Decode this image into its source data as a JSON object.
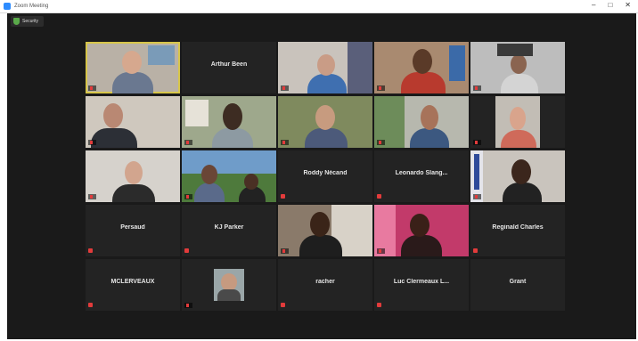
{
  "window": {
    "title": "Zoom Meeting"
  },
  "toolbar": {
    "security_label": "Security"
  },
  "colors": {
    "speaking_border": "#d7c64a",
    "mute": "#e23b3b",
    "tile_bg": "#232323",
    "meeting_bg": "#1a1a1a"
  },
  "participants": [
    {
      "name": "",
      "video": true
    },
    {
      "name": "Arthur Been",
      "video": false
    },
    {
      "name": "",
      "video": true
    },
    {
      "name": "",
      "video": true
    },
    {
      "name": "",
      "video": true
    },
    {
      "name": "",
      "video": true
    },
    {
      "name": "",
      "video": true
    },
    {
      "name": "",
      "video": true
    },
    {
      "name": "",
      "video": true
    },
    {
      "name": "",
      "video": true
    },
    {
      "name": "",
      "video": true
    },
    {
      "name": "",
      "video": true
    },
    {
      "name": "Roddy Nécand",
      "video": false
    },
    {
      "name": "Leonardo Slang...",
      "video": false
    },
    {
      "name": "",
      "video": true
    },
    {
      "name": "Persaud",
      "video": false
    },
    {
      "name": "KJ Parker",
      "video": false
    },
    {
      "name": "",
      "video": true
    },
    {
      "name": "",
      "video": true
    },
    {
      "name": "Reginald Charles",
      "video": false
    },
    {
      "name": "MCLERVEAUX",
      "video": false
    },
    {
      "name": "",
      "video": true
    },
    {
      "name": "racher",
      "video": false
    },
    {
      "name": "Luc Clermeaux L...",
      "video": false
    },
    {
      "name": "Grant",
      "video": false
    }
  ]
}
